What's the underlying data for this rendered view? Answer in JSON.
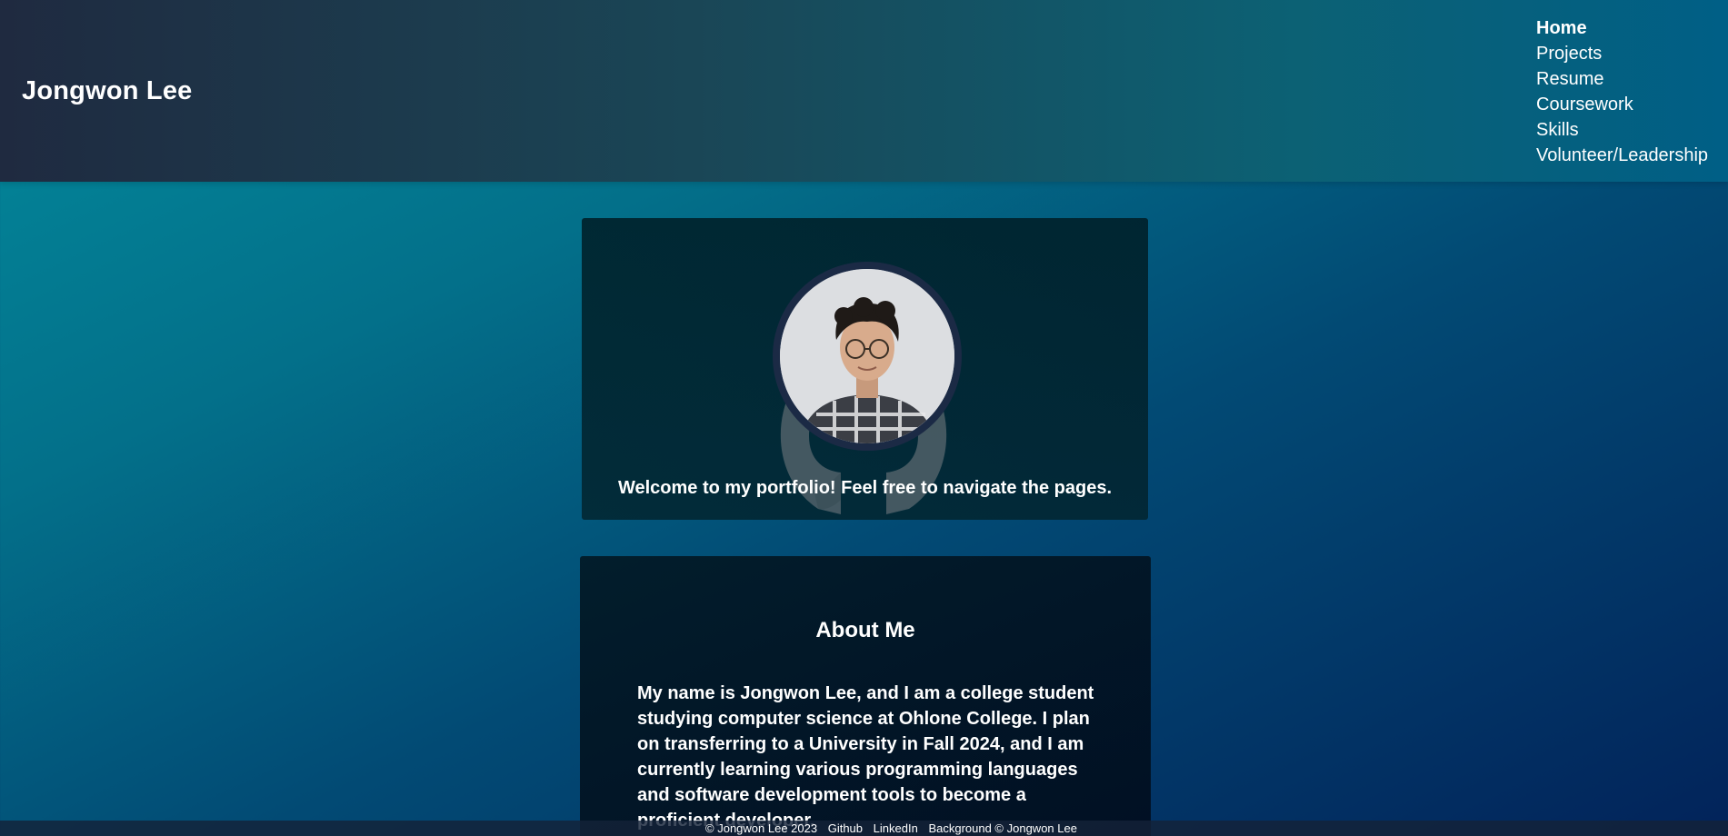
{
  "header": {
    "site_title": "Jongwon Lee",
    "nav": [
      {
        "label": "Home",
        "active": true
      },
      {
        "label": "Projects",
        "active": false
      },
      {
        "label": "Resume",
        "active": false
      },
      {
        "label": "Coursework",
        "active": false
      },
      {
        "label": "Skills",
        "active": false
      },
      {
        "label": "Volunteer/Leadership",
        "active": false
      }
    ]
  },
  "welcome": {
    "text": "Welcome to my portfolio! Feel free to navigate the pages."
  },
  "about": {
    "title": "About Me",
    "text": "My name is Jongwon Lee, and I am a college student studying computer science at Ohlone College. I plan on transferring to a University in Fall 2024, and I am currently learning various programming languages and software development tools to become a proficient developer."
  },
  "footer": {
    "copyright": "© Jongwon Lee 2023",
    "github": "Github",
    "linkedin": "LinkedIn",
    "background_credit": "Background © Jongwon Lee"
  },
  "colors": {
    "header_start": "#1f2a40",
    "header_end": "#005f86",
    "page_gradient_start": "#038a9c",
    "page_gradient_end": "#02235a",
    "avatar_border": "#1b2a45"
  }
}
